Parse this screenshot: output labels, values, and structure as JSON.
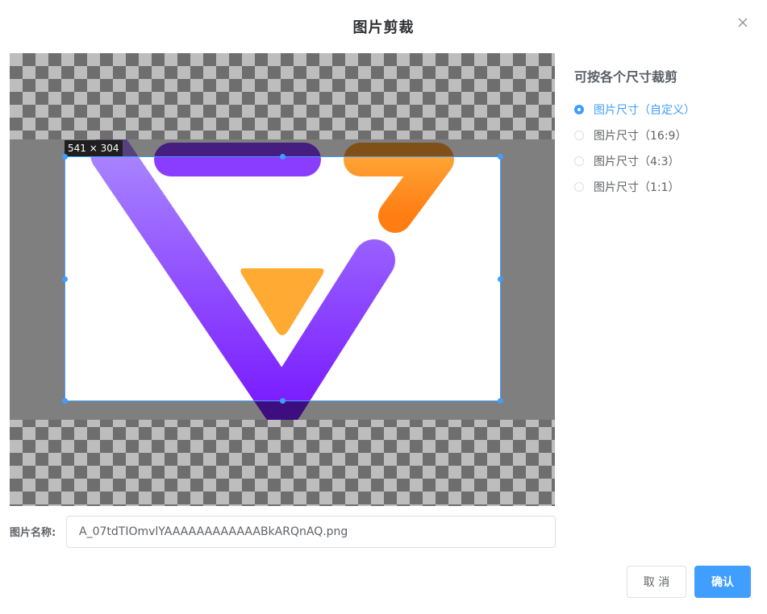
{
  "dialog": {
    "title": "图片剪裁"
  },
  "crop": {
    "size_label": "541 × 304"
  },
  "right_panel": {
    "title": "可按各个尺寸裁剪",
    "options": [
      {
        "label": "图片尺寸（自定义）",
        "checked": true
      },
      {
        "label": "图片尺寸（16:9）",
        "checked": false
      },
      {
        "label": "图片尺寸（4:3）",
        "checked": false
      },
      {
        "label": "图片尺寸（1:1）",
        "checked": false
      }
    ]
  },
  "name_field": {
    "label": "图片名称:",
    "value": "A_07tdTIOmvlYAAAAAAAAAAAABkARQnAQ.png"
  },
  "buttons": {
    "cancel": "取 消",
    "confirm": "确认"
  },
  "colors": {
    "accent": "#409eff",
    "logo_purple": "#7b2cff",
    "logo_orange": "#ff9422"
  },
  "icons": {
    "close": "close-icon"
  }
}
